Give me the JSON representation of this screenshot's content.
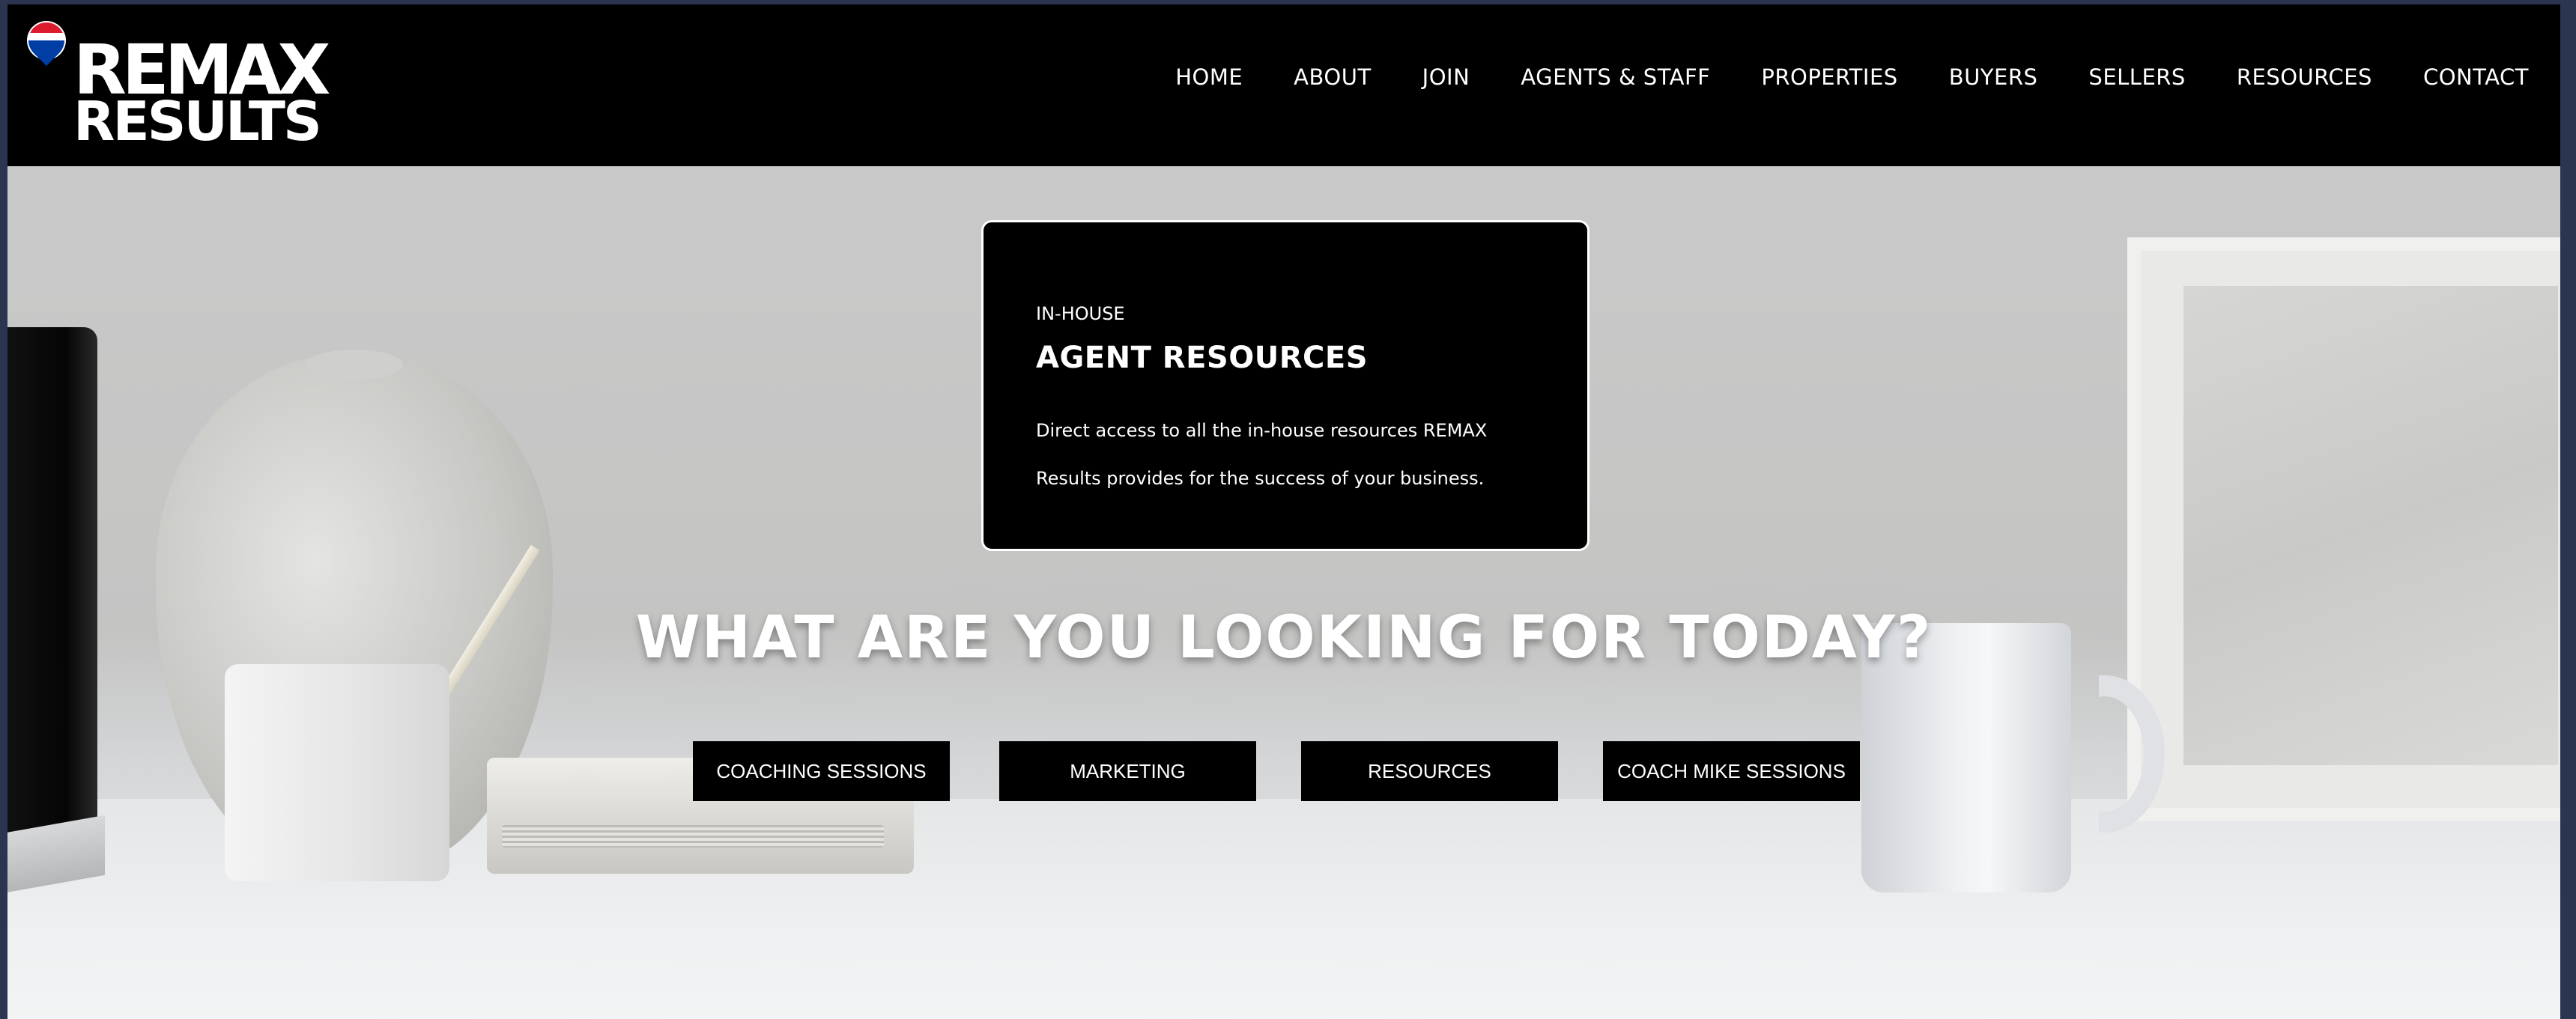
{
  "brand": {
    "name_top": "REMAX",
    "name_bottom": "RESULTS",
    "balloon_colors": [
      "#ffffff",
      "#dc1c2e",
      "#003da5"
    ]
  },
  "nav": {
    "items": [
      "HOME",
      "ABOUT",
      "JOIN",
      "AGENTS & STAFF",
      "PROPERTIES",
      "BUYERS",
      "SELLERS",
      "RESOURCES",
      "CONTACT"
    ]
  },
  "card": {
    "eyebrow": "IN-HOUSE",
    "title": "AGENT RESOURCES",
    "text_line1": "Direct access to all the in-house resources REMAX",
    "text_line2": "Results provides for the success of your business."
  },
  "hero": {
    "headline": "WHAT ARE YOU LOOKING FOR TODAY?",
    "buttons": [
      "COACHING SESSIONS",
      "MARKETING",
      "RESOURCES",
      "COACH MIKE SESSIONS"
    ]
  }
}
